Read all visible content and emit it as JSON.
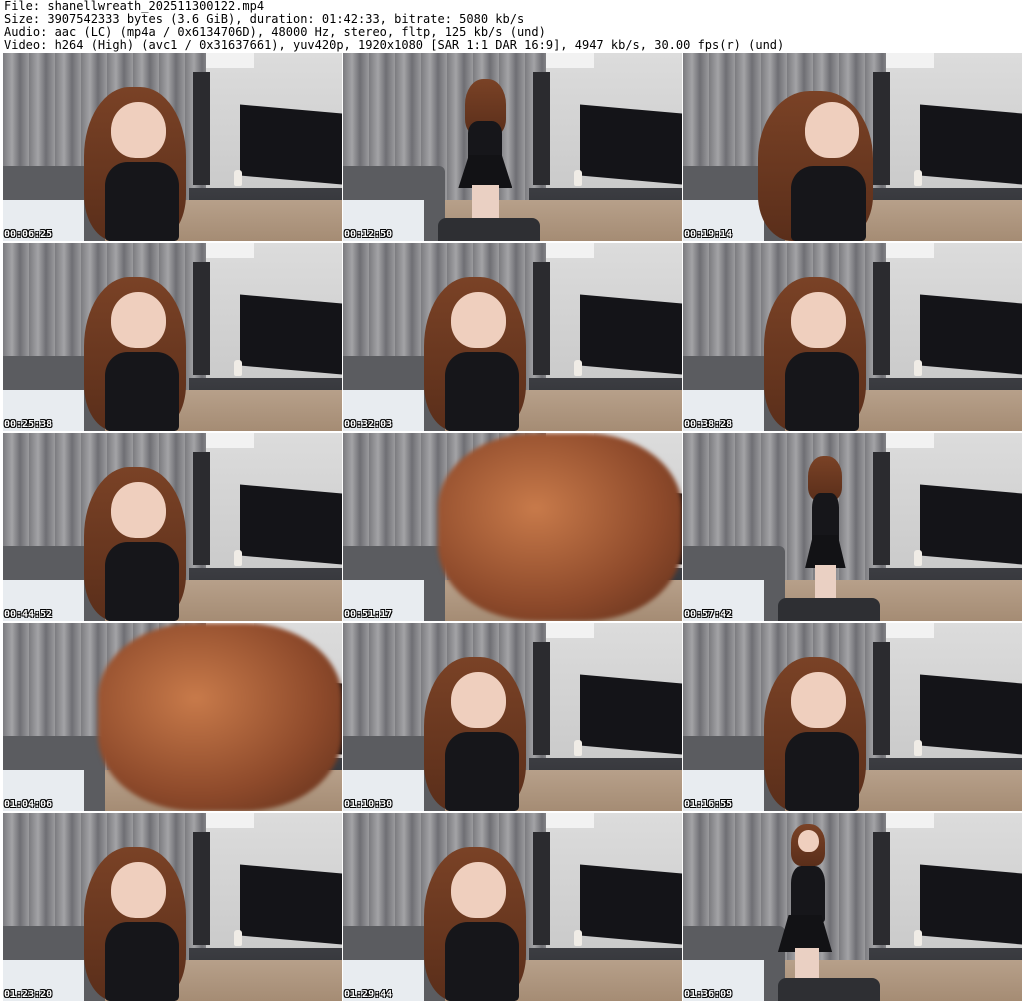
{
  "header": {
    "file_line": "File: shanellwreath_202511300122.mp4",
    "size_line": "Size: 3907542333 bytes (3.6 GiB), duration: 01:42:33, bitrate: 5080 kb/s",
    "audio_line": "Audio: aac (LC) (mp4a / 0x6134706D), 48000 Hz, stereo, fltp, 125 kb/s (und)",
    "video_line": "Video: h264 (High) (avc1 / 0x31637661), yuv420p, 1920x1080 [SAR 1:1 DAR 16:9], 4947 kb/s, 30.00 fps(r) (und)"
  },
  "thumbnails": [
    {
      "timestamp": "00:06:25",
      "pose": "seated-center"
    },
    {
      "timestamp": "00:12:50",
      "pose": "standing-back"
    },
    {
      "timestamp": "00:19:14",
      "pose": "seated-right"
    },
    {
      "timestamp": "00:25:38",
      "pose": "seated-center"
    },
    {
      "timestamp": "00:32:03",
      "pose": "seated-center"
    },
    {
      "timestamp": "00:38:28",
      "pose": "seated-center"
    },
    {
      "timestamp": "00:44:52",
      "pose": "seated-center"
    },
    {
      "timestamp": "00:51:17",
      "pose": "blur-closeup"
    },
    {
      "timestamp": "00:57:42",
      "pose": "standing-right"
    },
    {
      "timestamp": "01:04:06",
      "pose": "blur-closeup"
    },
    {
      "timestamp": "01:10:30",
      "pose": "seated-center"
    },
    {
      "timestamp": "01:16:55",
      "pose": "seated-center"
    },
    {
      "timestamp": "01:23:20",
      "pose": "seated-center"
    },
    {
      "timestamp": "01:29:44",
      "pose": "seated-center"
    },
    {
      "timestamp": "01:36:09",
      "pose": "standing-center"
    }
  ]
}
